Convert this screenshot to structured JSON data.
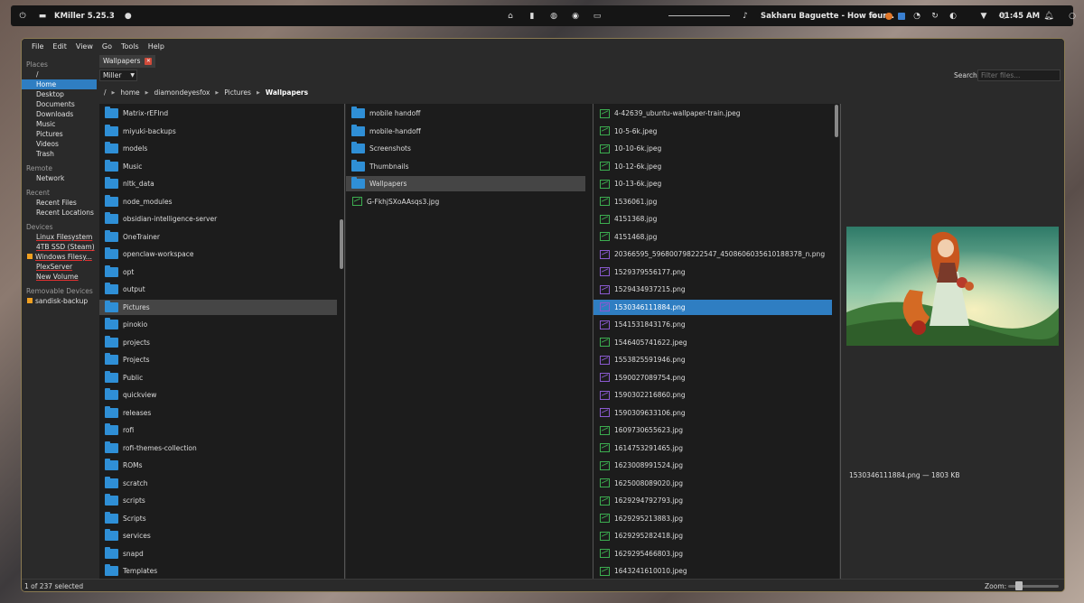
{
  "panel": {
    "app_title": "KMiller 5.25.3",
    "media_title": "Sakharu Baguette - How four...",
    "clock": "01:45 AM"
  },
  "menu": [
    "File",
    "Edit",
    "View",
    "Go",
    "Tools",
    "Help"
  ],
  "sidebar": {
    "places_header": "Places",
    "places": [
      "/",
      "Home",
      "Desktop",
      "Documents",
      "Downloads",
      "Music",
      "Pictures",
      "Videos",
      "Trash"
    ],
    "remote_header": "Remote",
    "remote": [
      "Network"
    ],
    "recent_header": "Recent",
    "recent": [
      "Recent Files",
      "Recent Locations"
    ],
    "devices_header": "Devices",
    "devices": [
      "Linux Filesystem",
      "4TB SSD (Steam)",
      "Windows Filesy...",
      "PlexServer",
      "New Volume"
    ],
    "removable_header": "Removable Devices",
    "removable": [
      "sandisk-backup"
    ]
  },
  "tab": {
    "label": "Wallpapers"
  },
  "view": {
    "mode": "Miller",
    "search_label": "Search",
    "search_placeholder": "Filter files..."
  },
  "breadcrumb": [
    "/",
    "home",
    "diamondeyesfox",
    "Pictures",
    "Wallpapers"
  ],
  "col1": [
    "Matrix-rEFInd",
    "miyuki-backups",
    "models",
    "Music",
    "nltk_data",
    "node_modules",
    "obsidian-intelligence-server",
    "OneTrainer",
    "openclaw-workspace",
    "opt",
    "output",
    "Pictures",
    "pinokio",
    "projects",
    "Projects",
    "Public",
    "quickview",
    "releases",
    "rofi",
    "rofi-themes-collection",
    "ROMs",
    "scratch",
    "scripts",
    "Scripts",
    "services",
    "snapd",
    "Templates"
  ],
  "col2_folders": [
    "mobile handoff",
    "mobile-handoff",
    "Screenshots",
    "Thumbnails",
    "Wallpapers"
  ],
  "col2_files": [
    "G-FkhjSXoAAsqs3.jpg"
  ],
  "col3": [
    {
      "name": "4-42639_ubuntu-wallpaper-train.jpeg",
      "type": "jpg"
    },
    {
      "name": "10-5-6k.jpeg",
      "type": "jpg"
    },
    {
      "name": "10-10-6k.jpeg",
      "type": "jpg"
    },
    {
      "name": "10-12-6k.jpeg",
      "type": "jpg"
    },
    {
      "name": "10-13-6k.jpeg",
      "type": "jpg"
    },
    {
      "name": "1536061.jpg",
      "type": "jpg"
    },
    {
      "name": "4151368.jpg",
      "type": "jpg"
    },
    {
      "name": "4151468.jpg",
      "type": "jpg"
    },
    {
      "name": "20366595_596800798222547_4508606035610188378_n.png",
      "type": "png"
    },
    {
      "name": "1529379556177.png",
      "type": "png"
    },
    {
      "name": "1529434937215.png",
      "type": "png"
    },
    {
      "name": "1530346111884.png",
      "type": "png"
    },
    {
      "name": "1541531843176.png",
      "type": "png"
    },
    {
      "name": "1546405741622.jpeg",
      "type": "jpg"
    },
    {
      "name": "1553825591946.png",
      "type": "png"
    },
    {
      "name": "1590027089754.png",
      "type": "png"
    },
    {
      "name": "1590302216860.png",
      "type": "png"
    },
    {
      "name": "1590309633106.png",
      "type": "png"
    },
    {
      "name": "1609730655623.jpg",
      "type": "jpg"
    },
    {
      "name": "1614753291465.jpg",
      "type": "jpg"
    },
    {
      "name": "1623008991524.jpg",
      "type": "jpg"
    },
    {
      "name": "1625008089020.jpg",
      "type": "jpg"
    },
    {
      "name": "1629294792793.jpg",
      "type": "jpg"
    },
    {
      "name": "1629295213883.jpg",
      "type": "jpg"
    },
    {
      "name": "1629295282418.jpg",
      "type": "jpg"
    },
    {
      "name": "1629295466803.jpg",
      "type": "jpg"
    },
    {
      "name": "1643241610010.jpeg",
      "type": "jpg"
    }
  ],
  "preview": {
    "caption": "1530346111884.png — 1803 KB"
  },
  "status": {
    "count": "1 of 237 selected",
    "zoom_label": "Zoom:"
  },
  "colors": {
    "accent": "#2f7ec2",
    "folder": "#2f8fd6",
    "jpg_icon": "#3cae50",
    "png_icon": "#8a5ad0"
  },
  "icons": {
    "folder": "folder-icon",
    "image": "image-file-icon",
    "close": "close-icon"
  }
}
